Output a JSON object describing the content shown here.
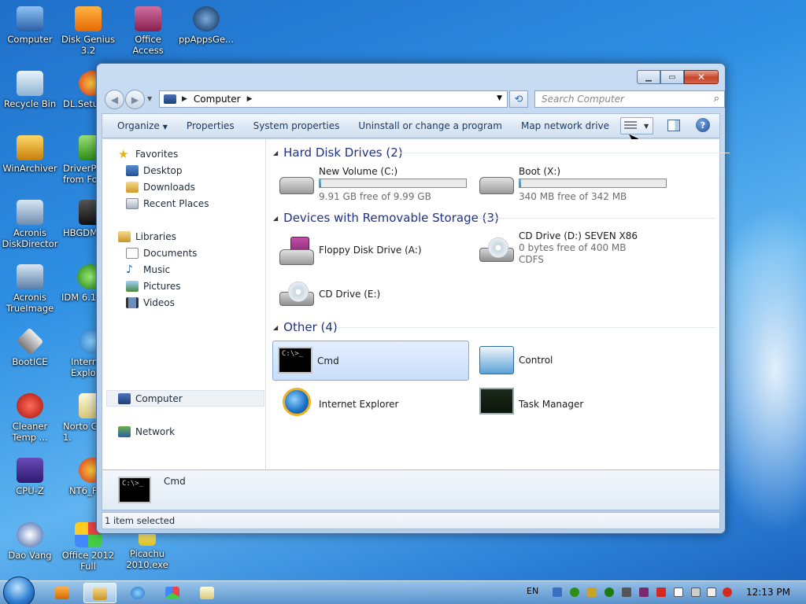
{
  "desktop": {
    "icons": [
      {
        "label": "Computer"
      },
      {
        "label": "Disk Genius 3.2"
      },
      {
        "label": "Office Access"
      },
      {
        "label": "ppAppsGe..."
      },
      {
        "label": "Recycle Bin"
      },
      {
        "label": "DL.Setup"
      },
      {
        "label": "WinArchiver"
      },
      {
        "label": "DriverPa from Fo"
      },
      {
        "label": "Acronis DiskDirector"
      },
      {
        "label": "HBGDM"
      },
      {
        "label": "Acronis TrueImage"
      },
      {
        "label": "IDM 6.12"
      },
      {
        "label": "BootICE"
      },
      {
        "label": "Intern Explore"
      },
      {
        "label": "Cleaner Temp ..."
      },
      {
        "label": "Norto Ghost 1."
      },
      {
        "label": "CPU-Z"
      },
      {
        "label": "NT6_F"
      },
      {
        "label": "Dao Vang"
      },
      {
        "label": "Office 2012 Full"
      },
      {
        "label": "Picachu 2010.exe"
      }
    ]
  },
  "window": {
    "address": {
      "path": "Computer"
    },
    "search": {
      "placeholder": "Search Computer"
    },
    "toolbar": {
      "organize": "Organize",
      "properties": "Properties",
      "system_properties": "System properties",
      "uninstall": "Uninstall or change a program",
      "map_drive": "Map network drive",
      "more": "»"
    },
    "navpane": {
      "favorites": "Favorites",
      "desktop": "Desktop",
      "downloads": "Downloads",
      "recent": "Recent Places",
      "libraries": "Libraries",
      "documents": "Documents",
      "music": "Music",
      "pictures": "Pictures",
      "videos": "Videos",
      "computer": "Computer",
      "network": "Network"
    },
    "groups": {
      "hdd": "Hard Disk Drives (2)",
      "removable": "Devices with Removable Storage (3)",
      "other": "Other (4)"
    },
    "drives": {
      "c": {
        "name": "New Volume (C:)",
        "free": "9.91 GB free of 9.99 GB",
        "used_fraction": 0.01
      },
      "x": {
        "name": "Boot (X:)",
        "free": "340 MB free of 342 MB",
        "used_fraction": 0.006
      }
    },
    "removable": {
      "floppy": {
        "name": "Floppy Disk Drive (A:)"
      },
      "cd_d": {
        "name": "CD Drive (D:) SEVEN X86",
        "free": "0 bytes free of 400 MB",
        "fs": "CDFS"
      },
      "cd_e": {
        "name": "CD Drive (E:)"
      }
    },
    "other": {
      "cmd": {
        "name": "Cmd",
        "icon_text": "C:\\>_"
      },
      "control": {
        "name": "Control"
      },
      "ie": {
        "name": "Internet Explorer"
      },
      "taskmgr": {
        "name": "Task Manager"
      }
    },
    "details": {
      "name": "Cmd",
      "icon_text": "C:\\>_"
    },
    "status": "1 item selected"
  },
  "taskbar": {
    "lang": "EN",
    "clock": "12:13 PM"
  },
  "colors": {
    "accent": "#1e3287",
    "selection": "#c9defb",
    "bar_fill": "#2794d4"
  }
}
